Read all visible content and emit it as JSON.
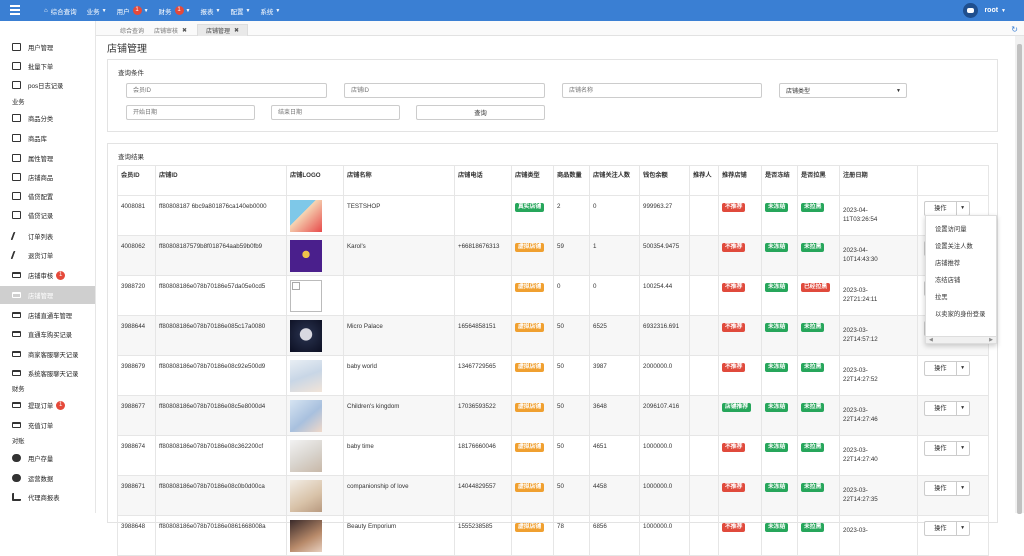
{
  "topbar": {
    "nav": [
      {
        "label": "综合查询",
        "home": true
      },
      {
        "label": "业务",
        "caret": true
      },
      {
        "label": "用户",
        "badge": "1",
        "caret": true
      },
      {
        "label": "财务",
        "badge": "1",
        "caret": true
      },
      {
        "label": "报表",
        "caret": true
      },
      {
        "label": "配置",
        "caret": true
      },
      {
        "label": "系统",
        "caret": true
      }
    ],
    "user": "root",
    "brand_color": "#3a7fd3"
  },
  "sidebar": {
    "items": [
      {
        "label": "用户管理",
        "icon": "user-list-icon"
      },
      {
        "label": "批量下单",
        "icon": "table-icon"
      },
      {
        "label": "pos日志记录",
        "icon": "table-icon"
      },
      {
        "label": "商品分类",
        "icon": "laptop-icon"
      },
      {
        "label": "商品库",
        "icon": "table-icon"
      },
      {
        "label": "属性管理",
        "icon": "table-icon"
      },
      {
        "label": "店铺商品",
        "icon": "table-icon"
      },
      {
        "label": "借贷配置",
        "icon": "table-icon"
      },
      {
        "label": "借贷记录",
        "icon": "table-icon"
      },
      {
        "label": "订单列表",
        "icon": "pencil-icon"
      },
      {
        "label": "退货订单",
        "icon": "pencil-icon"
      },
      {
        "label": "店铺审核",
        "icon": "card-icon",
        "badge": "1"
      },
      {
        "label": "店铺管理",
        "icon": "card-icon",
        "active": true
      },
      {
        "label": "店铺直通车管理",
        "icon": "card-icon"
      },
      {
        "label": "直通车购买记录",
        "icon": "card-icon"
      },
      {
        "label": "商家客服聊天记录",
        "icon": "card-icon"
      },
      {
        "label": "系统客服聊天记录",
        "icon": "card-icon"
      },
      {
        "label": "提现订单",
        "icon": "card-icon",
        "badge": "1"
      },
      {
        "label": "充值订单",
        "icon": "card-icon"
      },
      {
        "label": "用户存量",
        "icon": "pie-icon"
      },
      {
        "label": "运营数据",
        "icon": "pie-icon"
      },
      {
        "label": "代理商报表",
        "icon": "sitemap-icon"
      }
    ],
    "groups": {
      "business": "业务",
      "finance": "财务",
      "report": "对账"
    }
  },
  "tabs": [
    {
      "label": "综合查询"
    },
    {
      "label": "店铺审核",
      "close": "✖"
    },
    {
      "label": "店铺管理",
      "close": "✖",
      "active": true
    }
  ],
  "page_title": "店铺管理",
  "query": {
    "title": "查询条件",
    "placeholders": {
      "user_id": "会员ID",
      "shop_id": "店铺ID",
      "shop_name": "店铺名称",
      "start_date": "开始日期",
      "end_date": "结束日期"
    },
    "shop_type_select": "店铺类型",
    "submit": "查询"
  },
  "results": {
    "title": "查询结果",
    "columns": [
      "会员ID",
      "店铺ID",
      "店铺LOGO",
      "店铺名称",
      "店铺电话",
      "店铺类型",
      "商品数量",
      "店铺关注人数",
      "钱包余额",
      "推荐人",
      "推荐店铺",
      "是否冻结",
      "是否拉黑",
      "注册日期",
      ""
    ],
    "op_label": "操作",
    "rows": [
      {
        "uid": "4008081",
        "shop_id": "ff80808187 6bc9a801876ca140eb0000",
        "logo": "logo-cartoon",
        "name": "TESTSHOP",
        "phone": "",
        "type": "真实店铺",
        "type_color": "green",
        "goods": "2",
        "fans": "0",
        "balance": "999963.27",
        "referrer": "",
        "recommend": "不推荐",
        "rec_color": "red",
        "frozen": "未冻结",
        "blacklist": "未拉黑",
        "black_color": "green",
        "date1": "2023-04-",
        "date2": "11T03:26:54"
      },
      {
        "uid": "4008062",
        "shop_id": "ff80808187579b8f018764aab59b0fb9",
        "logo": "logo-purple",
        "name": "Karol's",
        "phone": "+66818676313",
        "type": "虚拟店铺",
        "type_color": "orange",
        "goods": "59",
        "fans": "1",
        "balance": "500354.9475",
        "referrer": "",
        "recommend": "不推荐",
        "rec_color": "red",
        "frozen": "未冻结",
        "blacklist": "未拉黑",
        "black_color": "green",
        "date1": "2023-04-",
        "date2": "10T14:43:30"
      },
      {
        "uid": "3988720",
        "shop_id": "ff80808186e078b70186e57da05e0cd5",
        "logo": "broken",
        "name": "",
        "phone": "",
        "type": "虚拟店铺",
        "type_color": "orange",
        "goods": "0",
        "fans": "0",
        "balance": "100254.44",
        "referrer": "",
        "recommend": "不推荐",
        "rec_color": "red",
        "frozen": "未冻结",
        "blacklist": "已经拉黑",
        "black_color": "red",
        "date1": "2023-03-",
        "date2": "22T21:24:11"
      },
      {
        "uid": "3988644",
        "shop_id": "ff80808186e078b70186e085c17a0080",
        "logo": "logo-astronaut",
        "name": "Micro Palace",
        "phone": "16564858151",
        "type": "虚拟店铺",
        "type_color": "orange",
        "goods": "50",
        "fans": "6525",
        "balance": "6932316.691",
        "referrer": "",
        "recommend": "不推荐",
        "rec_color": "red",
        "frozen": "未冻结",
        "blacklist": "未拉黑",
        "black_color": "green",
        "date1": "2023-03-",
        "date2": "22T14:57:12"
      },
      {
        "uid": "3988679",
        "shop_id": "ff80808186e078b70186e08c92e500d9",
        "logo": "logo-baby",
        "name": "baby world",
        "phone": "13467729565",
        "type": "虚拟店铺",
        "type_color": "orange",
        "goods": "50",
        "fans": "3987",
        "balance": "2000000.0",
        "referrer": "",
        "recommend": "不推荐",
        "rec_color": "red",
        "frozen": "未冻结",
        "blacklist": "未拉黑",
        "black_color": "green",
        "date1": "2023-03-",
        "date2": "22T14:27:52"
      },
      {
        "uid": "3988677",
        "shop_id": "ff80808186e078b70186e08c5e8000d4",
        "logo": "logo-kids",
        "name": "Children's kingdom",
        "phone": "17036593522",
        "type": "虚拟店铺",
        "type_color": "orange",
        "goods": "50",
        "fans": "3648",
        "balance": "2096107.416",
        "referrer": "",
        "recommend": "店铺推荐",
        "rec_color": "green",
        "frozen": "未冻结",
        "blacklist": "未拉黑",
        "black_color": "green",
        "date1": "2023-03-",
        "date2": "22T14:27:46"
      },
      {
        "uid": "3988674",
        "shop_id": "ff80808186e078b70186e08c362200cf",
        "logo": "logo-babytime",
        "name": "baby time",
        "phone": "18176660046",
        "type": "虚拟店铺",
        "type_color": "orange",
        "goods": "50",
        "fans": "4651",
        "balance": "1000000.0",
        "referrer": "",
        "recommend": "不推荐",
        "rec_color": "red",
        "frozen": "未冻结",
        "blacklist": "未拉黑",
        "black_color": "green",
        "date1": "2023-03-",
        "date2": "22T14:27:40"
      },
      {
        "uid": "3988671",
        "shop_id": "ff80808186e078b70186e08c0b0d00ca",
        "logo": "logo-companion",
        "name": "companionship of love",
        "phone": "14044829557",
        "type": "虚拟店铺",
        "type_color": "orange",
        "goods": "50",
        "fans": "4458",
        "balance": "1000000.0",
        "referrer": "",
        "recommend": "不推荐",
        "rec_color": "red",
        "frozen": "未冻结",
        "blacklist": "未拉黑",
        "black_color": "green",
        "date1": "2023-03-",
        "date2": "22T14:27:35"
      },
      {
        "uid": "3988648",
        "shop_id": "ff80808186e078b70186e0861668008a",
        "logo": "logo-beauty",
        "name": "Beauty Emporium",
        "phone": "1555238585",
        "type": "虚拟店铺",
        "type_color": "orange",
        "goods": "78",
        "fans": "6856",
        "balance": "1000000.0",
        "referrer": "",
        "recommend": "不推荐",
        "rec_color": "red",
        "frozen": "未冻结",
        "blacklist": "未拉黑",
        "black_color": "green",
        "date1": "2023-03-",
        "date2": ""
      }
    ]
  },
  "dropdown": {
    "items": [
      "设置访问量",
      "设置关注人数",
      "店铺推荐",
      "冻结店铺",
      "拉黑",
      "以卖家的身份登录"
    ]
  },
  "colors": {
    "green": "#26a65b",
    "orange": "#f0a030",
    "red": "#e04a3c"
  }
}
